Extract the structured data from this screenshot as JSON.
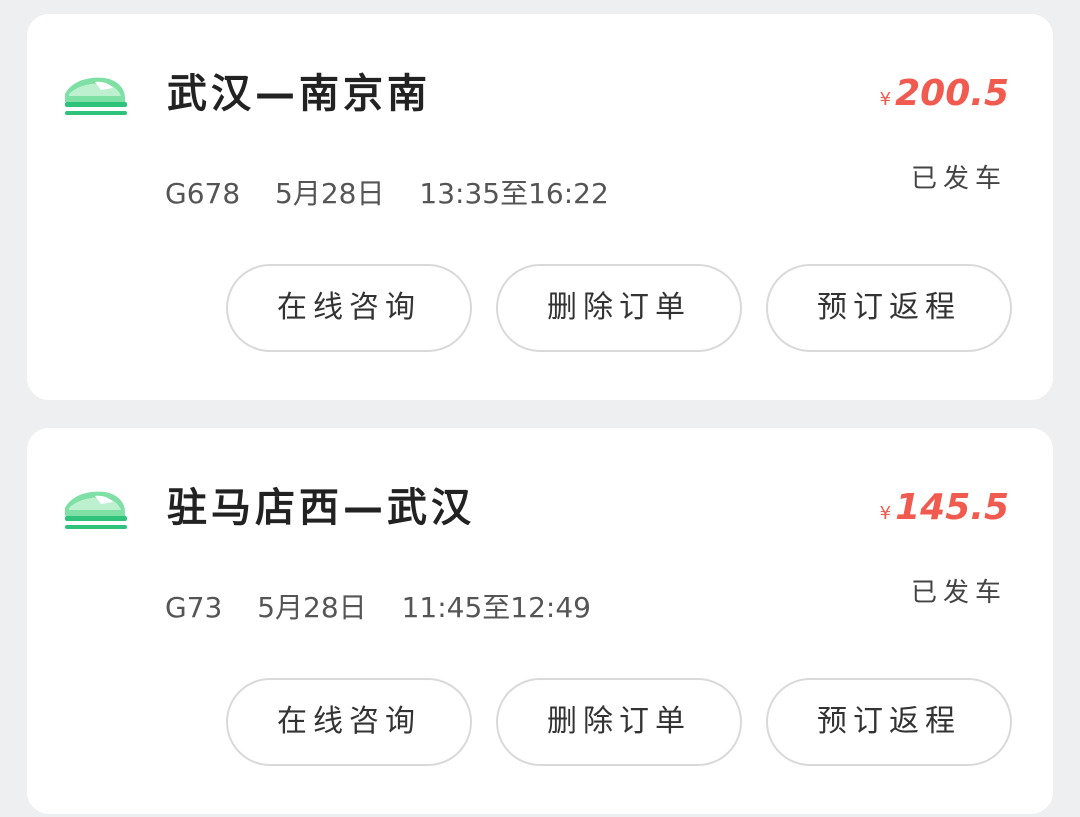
{
  "orders": [
    {
      "route": "武汉—南京南",
      "price_symbol": "¥",
      "price": "200.5",
      "status": "已发车",
      "train_no": "G678",
      "date": "5月28日",
      "time": "13:35至16:22",
      "buttons": {
        "consult": "在线咨询",
        "delete": "删除订单",
        "return": "预订返程"
      }
    },
    {
      "route": "驻马店西—武汉",
      "price_symbol": "¥",
      "price": "145.5",
      "status": "已发车",
      "train_no": "G73",
      "date": "5月28日",
      "time": "11:45至12:49",
      "buttons": {
        "consult": "在线咨询",
        "delete": "删除订单",
        "return": "预订返程"
      }
    }
  ],
  "colors": {
    "price": "#f05a4f",
    "icon_green": "#2fc27a",
    "icon_light": "#7ee0a4",
    "background": "#eeeff1"
  },
  "icons": {
    "train": "high-speed-train-icon"
  }
}
